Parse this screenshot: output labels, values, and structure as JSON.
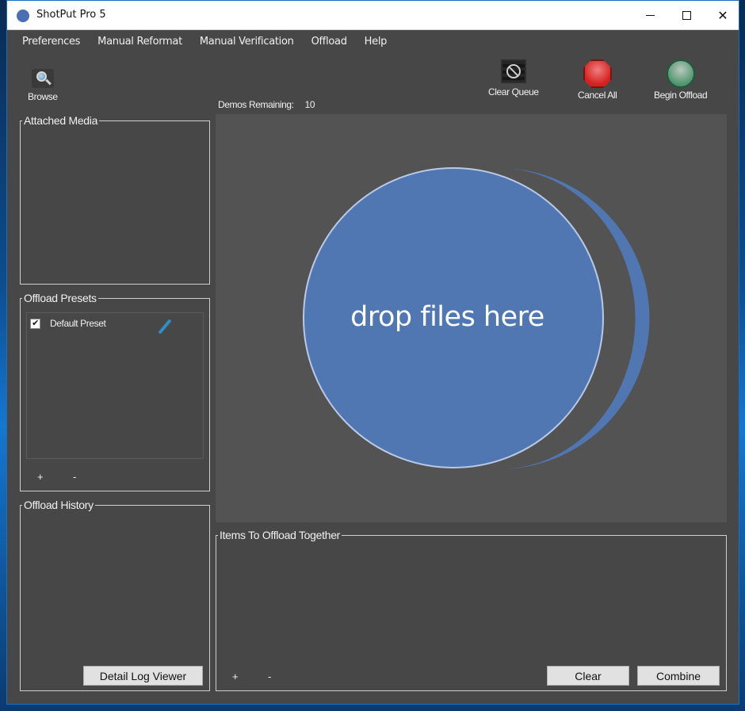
{
  "window": {
    "title": "ShotPut Pro 5",
    "controls": {
      "minimize": "minimize",
      "maximize": "maximize",
      "close": "✕"
    }
  },
  "menu": {
    "items": [
      {
        "label": "Preferences"
      },
      {
        "label": "Manual Reformat"
      },
      {
        "label": "Manual Verification"
      },
      {
        "label": "Offload"
      },
      {
        "label": "Help"
      }
    ]
  },
  "toolbar": {
    "browse": {
      "label": "Browse",
      "icon": "magnifier-icon"
    },
    "clear_queue": {
      "label": "Clear Queue",
      "icon": "no-sign-icon"
    },
    "cancel_all": {
      "label": "Cancel All",
      "icon": "stop-sign-icon"
    },
    "begin_offload": {
      "label": "Begin Offload",
      "icon": "green-circle-icon"
    }
  },
  "demos": {
    "label": "Demos Remaining:",
    "value": "10"
  },
  "attached_media": {
    "title": "Attached Media"
  },
  "offload_presets": {
    "title": "Offload Presets",
    "items": [
      {
        "label": "Default Preset",
        "checked": true
      }
    ],
    "add_label": "+",
    "remove_label": "-"
  },
  "offload_history": {
    "title": "Offload History",
    "detail_log_button": "Detail Log Viewer"
  },
  "dropzone": {
    "text": "drop files here",
    "colors": {
      "fill": "#5177b3",
      "background": "#535353"
    }
  },
  "items_together": {
    "title": "Items To Offload Together",
    "add_label": "+",
    "remove_label": "-",
    "clear_button": "Clear",
    "combine_button": "Combine"
  }
}
